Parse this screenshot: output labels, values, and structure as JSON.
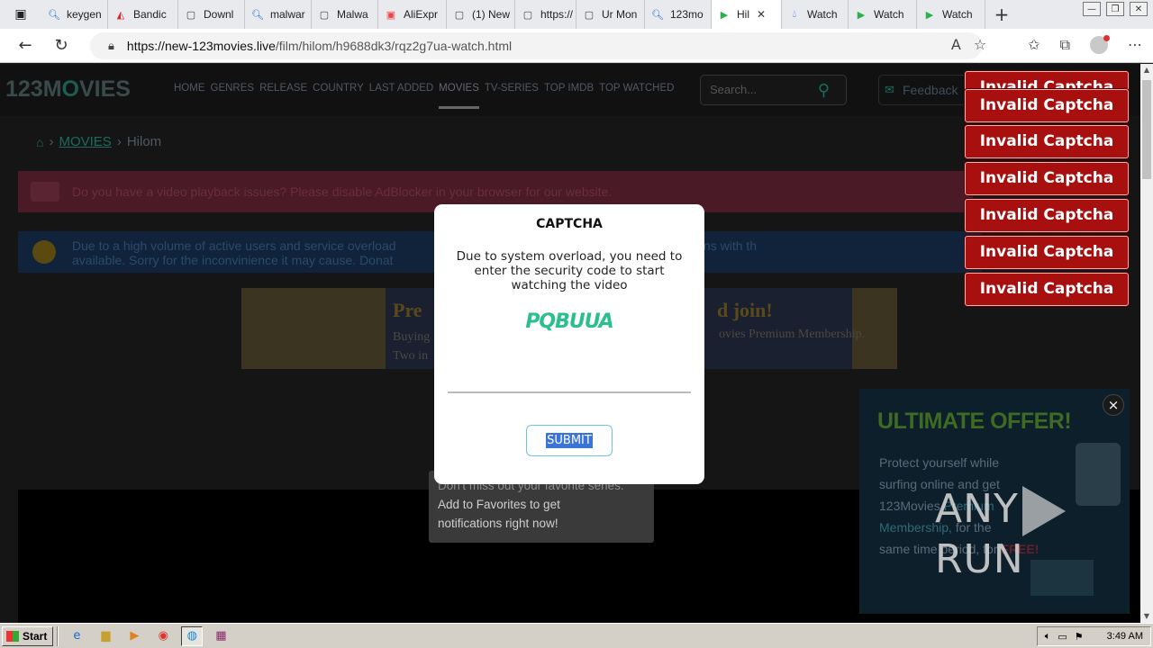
{
  "browser": {
    "tabs": [
      {
        "label": "keygen",
        "icon": "search-icon"
      },
      {
        "label": "Bandic",
        "icon": "bandicam-icon"
      },
      {
        "label": "Downl",
        "icon": "page-icon"
      },
      {
        "label": "malwar",
        "icon": "search-icon"
      },
      {
        "label": "Malwa",
        "icon": "page-icon"
      },
      {
        "label": "AliExpr",
        "icon": "aliexpress-icon"
      },
      {
        "label": "(1) New",
        "icon": "page-icon"
      },
      {
        "label": "https://",
        "icon": "page-icon"
      },
      {
        "label": "Ur Mon",
        "icon": "page-icon"
      },
      {
        "label": "123mo",
        "icon": "search-icon"
      },
      {
        "label": "Hil",
        "icon": "play-icon",
        "active": true
      },
      {
        "label": "Watch",
        "icon": "drop-icon"
      },
      {
        "label": "Watch",
        "icon": "play-icon"
      },
      {
        "label": "Watch",
        "icon": "play-icon"
      }
    ],
    "new_tab": "+",
    "url_host": "https://new-123movies.live",
    "url_path": "/film/hilom/h9688dk3/rqz2g7ua-watch.html"
  },
  "site": {
    "logo_a": "123M",
    "logo_o": "O",
    "logo_b": "VIES",
    "nav": [
      "HOME",
      "GENRES",
      "RELEASE",
      "COUNTRY",
      "LAST ADDED",
      "MOVIES",
      "TV-SERIES",
      "TOP IMDB",
      "TOP WATCHED"
    ],
    "search_placeholder": "Search...",
    "feedback": "Feedback",
    "breadcrumb_movies": "MOVIES",
    "breadcrumb_title": "Hilom",
    "alert_adblock": "Do you have a video playback issues? Please disable AdBlocker in your browser for our website.",
    "alert_overload_1": "Due to a high volume of active users and service overload",
    "alert_overload_2": "reaming. Premium users remains with th",
    "alert_overload_3": "available. Sorry for the inconvinience it may cause.",
    "alert_overload_4": "Donat",
    "banner_title_l": "Pre",
    "banner_title_r": "d join!",
    "banner_line1_l": "Buying",
    "banner_line2_l": "Two in",
    "banner_line1_r": "ovies Premium Membership."
  },
  "favorites_popup": {
    "line1": "Don't miss out your favorite series.",
    "line2": "Add to Favorites to get",
    "line3": "notifications right now!"
  },
  "offer": {
    "title": "ULTIMATE OFFER!",
    "t1": "Protect yourself while",
    "t2": "surfing online and get",
    "t3": "123Movies",
    "t3b": "Premium",
    "t4": "Membership,",
    "t4b": "for the",
    "t5": "same time period, for",
    "t5b": "FREE!",
    "close": "×"
  },
  "captcha": {
    "title": "CAPTCHA",
    "message": "Due to system overload, you need to enter the security code to start watching the video",
    "code": "PQBUUA",
    "input_value": "",
    "submit": "SUBMIT"
  },
  "toasts": [
    "Invalid Captcha",
    "Invalid Captcha",
    "Invalid Captcha",
    "Invalid Captcha",
    "Invalid Captcha",
    "Invalid Captcha",
    "Invalid Captcha"
  ],
  "watermark": {
    "left": "ANY",
    "right": "RUN"
  },
  "taskbar": {
    "start": "Start",
    "clock": "3:49 AM"
  }
}
